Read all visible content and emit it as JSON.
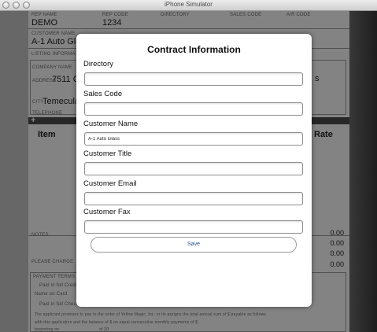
{
  "window": {
    "title": "iPhone Simulator"
  },
  "form": {
    "rep_name_label": "REP NAME",
    "rep_name_value": "DEMO",
    "rep_code_label": "REP CODE",
    "rep_code_value": "1234",
    "directory_label": "DIRECTORY",
    "sales_code_label": "SALES CODE",
    "ar_code_label": "A/R CODE",
    "customer_name_label": "CUSTOMER NAME",
    "customer_name_value": "A-1 Auto Gla",
    "listing_info_label": "LISTING INFORMATION",
    "company_name_label": "COMPANY NAME",
    "address_label": "ADDRESS",
    "address_value": "7511 C",
    "city_label": "CITY",
    "city_value": "Temecula",
    "telephone_label": "TELEPHONE",
    "col_item": "Item",
    "col_rate": "Rate",
    "right_s": "s",
    "amounts": [
      "0.00",
      "0.00",
      "0.00",
      "0.00"
    ],
    "notes_label": "NOTES:",
    "please_label": "PLEASE CHARGE",
    "payment_terms_label": "PAYMENT TERMS",
    "paid_full_label": "Paid in full Credit",
    "name_on_card_label": "Name on Card",
    "paid_check_label": "Paid in full Check #",
    "applicant_text": "The applicant promises to pay to the order of Yellow Magic, Inc. or its assigns the total annual sum of $ payable as follows",
    "balance_text": "with this application and the balance of $ on equal consecutive monthly payments of $",
    "beginning_label": "beginning on",
    "of_label": "of 20"
  },
  "modal": {
    "title": "Contract Information",
    "fields": [
      {
        "label": "Directory",
        "value": ""
      },
      {
        "label": "Sales Code",
        "value": ""
      },
      {
        "label": "Customer Name",
        "value": "A-1 Auto Glass"
      },
      {
        "label": "Customer Title",
        "value": ""
      },
      {
        "label": "Customer Email",
        "value": ""
      },
      {
        "label": "Customer Fax",
        "value": ""
      }
    ],
    "save_label": "Save"
  }
}
